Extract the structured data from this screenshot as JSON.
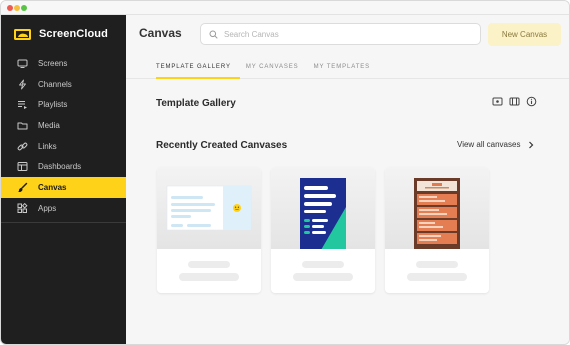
{
  "app": {
    "name": "ScreenCloud"
  },
  "sidebar": {
    "items": [
      {
        "label": "Screens",
        "icon": "monitor-icon",
        "active": false
      },
      {
        "label": "Channels",
        "icon": "lightning-icon",
        "active": false
      },
      {
        "label": "Playlists",
        "icon": "playlist-icon",
        "active": false
      },
      {
        "label": "Media",
        "icon": "folder-icon",
        "active": false
      },
      {
        "label": "Links",
        "icon": "link-icon",
        "active": false
      },
      {
        "label": "Dashboards",
        "icon": "dashboard-icon",
        "active": false
      },
      {
        "label": "Canvas",
        "icon": "brush-icon",
        "active": true
      },
      {
        "label": "Apps",
        "icon": "apps-icon",
        "active": false
      }
    ]
  },
  "header": {
    "title": "Canvas",
    "search_placeholder": "Search Canvas",
    "new_button": "New Canvas"
  },
  "tabs": [
    {
      "label": "TEMPLATE GALLERY",
      "active": true
    },
    {
      "label": "MY CANVASES",
      "active": false
    },
    {
      "label": "MY TEMPLATES",
      "active": false
    }
  ],
  "gallery": {
    "title": "Template Gallery"
  },
  "recent": {
    "title": "Recently Created Canvases",
    "view_all": "View all canvases"
  },
  "colors": {
    "accent": "#ffd21a",
    "sidebar_bg": "#1f1f1f",
    "new_button_bg": "#fbf2c8"
  }
}
